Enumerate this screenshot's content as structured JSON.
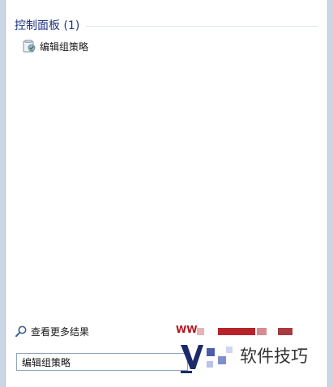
{
  "results": {
    "group_title": "控制面板 (1)",
    "items": [
      {
        "label": "编辑组策略",
        "icon": "group-policy-icon"
      }
    ]
  },
  "see_more": {
    "label": "查看更多结果",
    "icon": "search-icon"
  },
  "search": {
    "value": "编辑组策略"
  },
  "watermark": {
    "site_prefix": "WW",
    "brand_text": "软件技巧"
  },
  "colors": {
    "group_title": "#1e3287",
    "border": "#b9c4d1",
    "search_border": "#8ea3bd",
    "watermark_red": "#b0161e"
  }
}
